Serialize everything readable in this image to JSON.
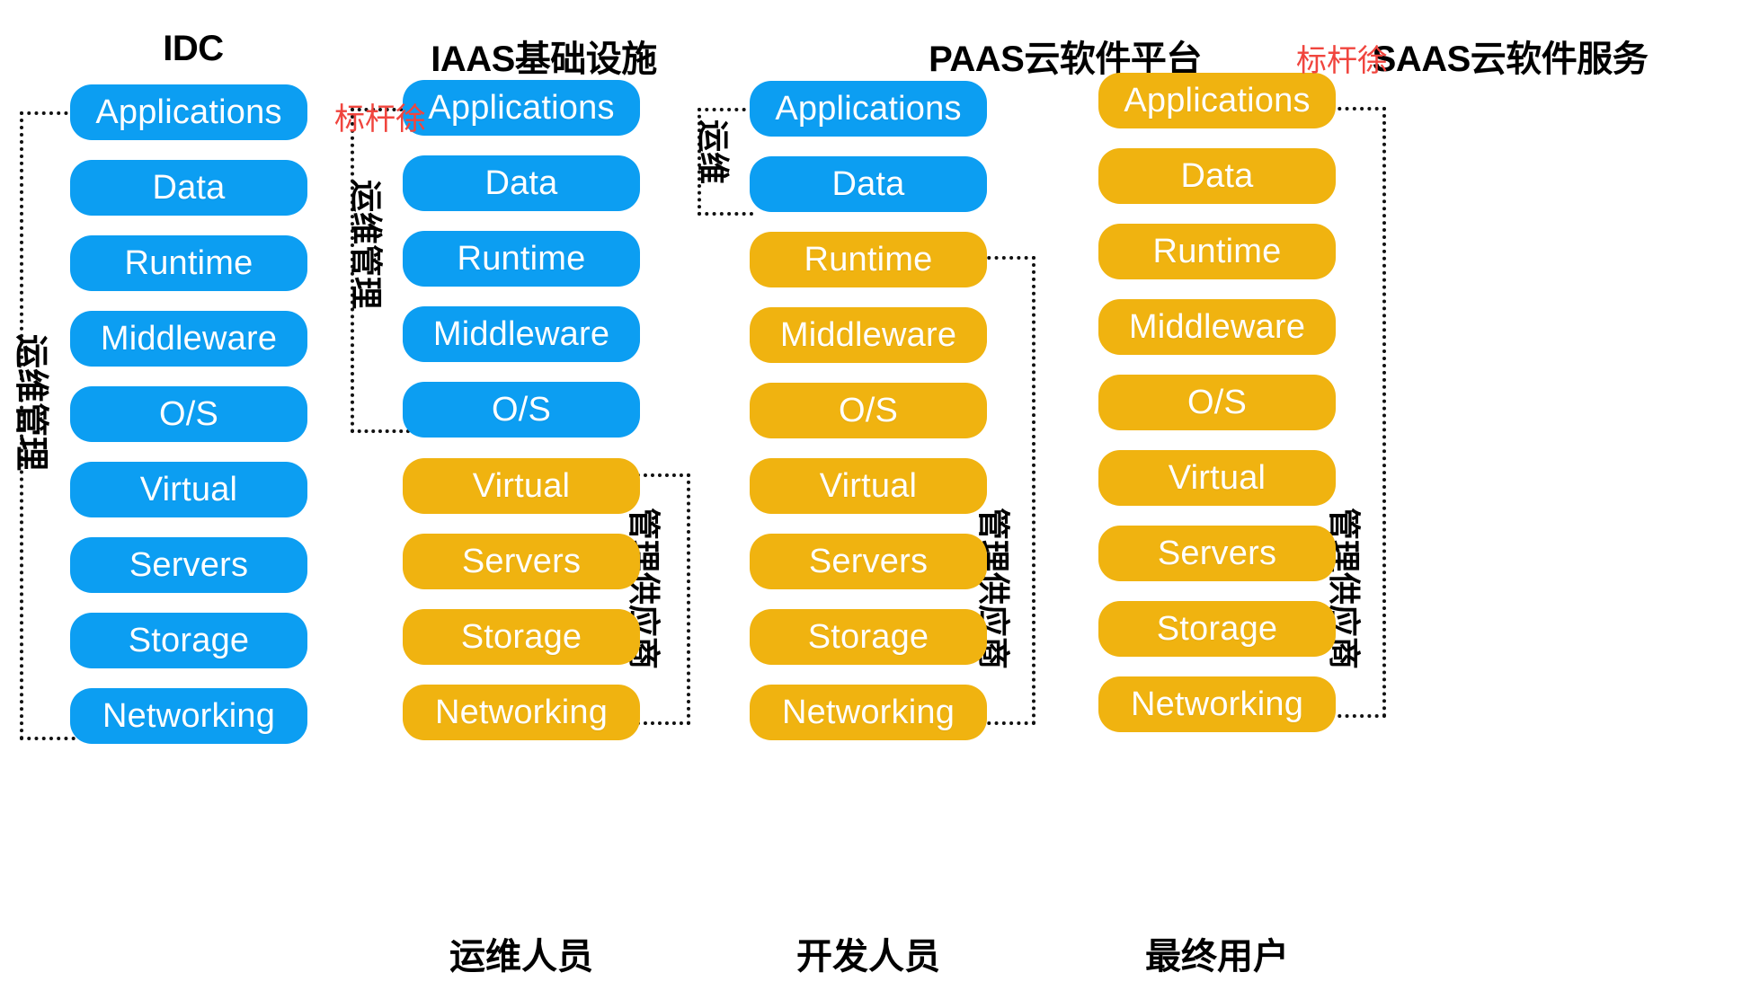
{
  "diagram": {
    "title_row": [
      {
        "id": "idc",
        "label": "IDC"
      },
      {
        "id": "iaas",
        "label": "IAAS基础设施"
      },
      {
        "id": "paas",
        "label": "PAAS云软件平台"
      },
      {
        "id": "saas",
        "label": "SAAS云软件服务"
      }
    ],
    "layer_names": [
      "Applications",
      "Data",
      "Runtime",
      "Middleware",
      "O/S",
      "Virtual",
      "Servers",
      "Storage",
      "Networking"
    ],
    "columns": [
      {
        "id": "idc",
        "title": "IDC",
        "layers": [
          {
            "label": "Applications",
            "color": "blue"
          },
          {
            "label": "Data",
            "color": "blue"
          },
          {
            "label": "Runtime",
            "color": "blue"
          },
          {
            "label": "Middleware",
            "color": "blue"
          },
          {
            "label": "O/S",
            "color": "blue"
          },
          {
            "label": "Virtual",
            "color": "blue"
          },
          {
            "label": "Servers",
            "color": "blue"
          },
          {
            "label": "Storage",
            "color": "blue"
          },
          {
            "label": "Networking",
            "color": "blue"
          }
        ],
        "left_bracket_label": "运维管理",
        "right_bracket_label": "",
        "role_label": ""
      },
      {
        "id": "iaas",
        "title": "IAAS基础设施",
        "layers": [
          {
            "label": "Applications",
            "color": "blue"
          },
          {
            "label": "Data",
            "color": "blue"
          },
          {
            "label": "Runtime",
            "color": "blue"
          },
          {
            "label": "Middleware",
            "color": "blue"
          },
          {
            "label": "O/S",
            "color": "blue"
          },
          {
            "label": "Virtual",
            "color": "orange"
          },
          {
            "label": "Servers",
            "color": "orange"
          },
          {
            "label": "Storage",
            "color": "orange"
          },
          {
            "label": "Networking",
            "color": "orange"
          }
        ],
        "left_bracket_label": "运维管理",
        "right_bracket_label": "管理供应商",
        "role_label": "运维人员"
      },
      {
        "id": "paas",
        "title": "PAAS云软件平台",
        "layers": [
          {
            "label": "Applications",
            "color": "blue"
          },
          {
            "label": "Data",
            "color": "blue"
          },
          {
            "label": "Runtime",
            "color": "orange"
          },
          {
            "label": "Middleware",
            "color": "orange"
          },
          {
            "label": "O/S",
            "color": "orange"
          },
          {
            "label": "Virtual",
            "color": "orange"
          },
          {
            "label": "Servers",
            "color": "orange"
          },
          {
            "label": "Storage",
            "color": "orange"
          },
          {
            "label": "Networking",
            "color": "orange"
          }
        ],
        "left_bracket_label": "运维",
        "right_bracket_label": "管理供应商",
        "role_label": "开发人员"
      },
      {
        "id": "saas",
        "title": "SAAS云软件服务",
        "layers": [
          {
            "label": "Applications",
            "color": "orange"
          },
          {
            "label": "Data",
            "color": "orange"
          },
          {
            "label": "Runtime",
            "color": "orange"
          },
          {
            "label": "Middleware",
            "color": "orange"
          },
          {
            "label": "O/S",
            "color": "orange"
          },
          {
            "label": "Virtual",
            "color": "orange"
          },
          {
            "label": "Servers",
            "color": "orange"
          },
          {
            "label": "Storage",
            "color": "orange"
          },
          {
            "label": "Networking",
            "color": "orange"
          }
        ],
        "left_bracket_label": "",
        "right_bracket_label": "管理供应商",
        "role_label": "最终用户"
      }
    ],
    "watermarks": [
      {
        "text": "标杆徐"
      },
      {
        "text": "标杆徐"
      }
    ],
    "colors": {
      "blue": "#0C9EF2",
      "orange": "#F0B310",
      "watermark_red": "#F0453E",
      "bracket": "#111111",
      "background": "#FFFFFF",
      "text_on_box": "#FFFFFF",
      "title_text": "#000000"
    }
  }
}
